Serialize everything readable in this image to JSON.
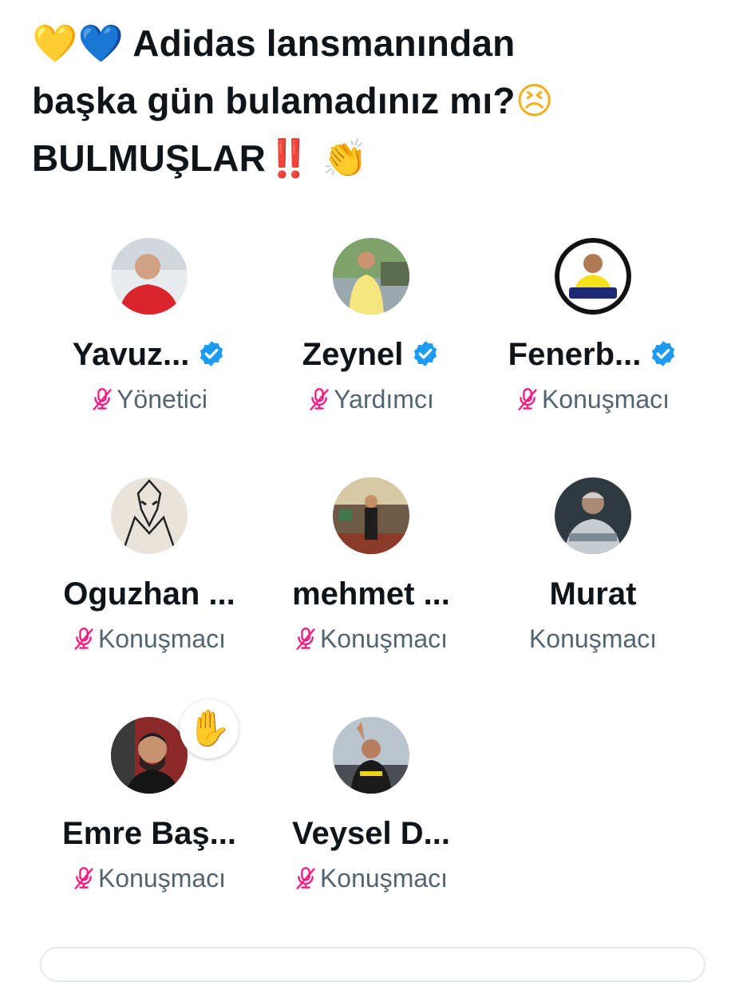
{
  "space": {
    "title_line1_text": "Adidas lansmanından",
    "title_line2_text": "başka gün bulamadınız mı?",
    "title_line3_text": "BULMUŞLAR",
    "emoji": {
      "heart_yellow": "💛",
      "heart_blue": "💙",
      "face": "😣",
      "bang": "‼️",
      "clap": "👏",
      "raised_hand": "✋"
    }
  },
  "participants": [
    {
      "name": "Yavuz...",
      "role": "Yönetici",
      "verified": true,
      "muted": true
    },
    {
      "name": "Zeynel",
      "role": "Yardımcı",
      "verified": true,
      "muted": true
    },
    {
      "name": "Fenerb...",
      "role": "Konuşmacı",
      "verified": true,
      "muted": true
    },
    {
      "name": "Oguzhan ...",
      "role": "Konuşmacı",
      "verified": false,
      "muted": true
    },
    {
      "name": "mehmet ...",
      "role": "Konuşmacı",
      "verified": false,
      "muted": true
    },
    {
      "name": "Murat",
      "role": "Konuşmacı",
      "verified": false,
      "muted": false
    },
    {
      "name": "Emre Baş...",
      "role": "Konuşmacı",
      "verified": false,
      "muted": true,
      "hand_raised": true
    },
    {
      "name": "Veysel D...",
      "role": "Konuşmacı",
      "verified": false,
      "muted": true
    }
  ],
  "colors": {
    "text": "#0f1419",
    "secondary": "#536471",
    "verified_blue": "#1d9bf0",
    "muted_mic_pink": "#f91880"
  }
}
